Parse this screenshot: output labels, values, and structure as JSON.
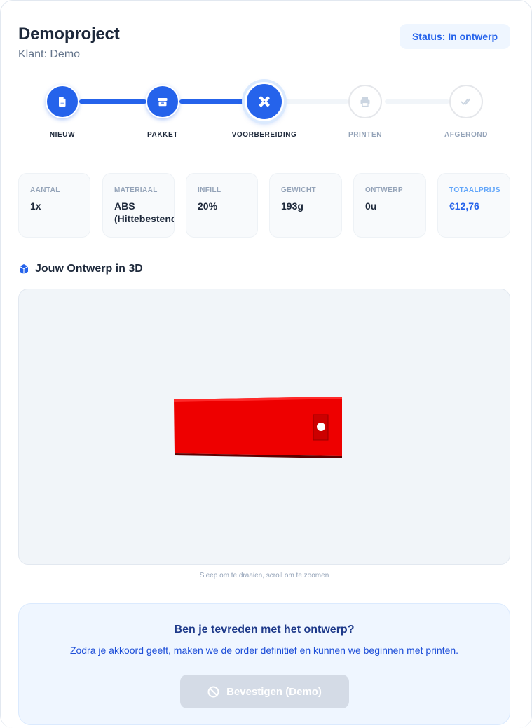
{
  "header": {
    "project_title": "Demoproject",
    "client": "Klant: Demo",
    "status": "Status: In ontwerp"
  },
  "steps": [
    {
      "label": "NIEUW",
      "icon": "document-icon",
      "state": "done"
    },
    {
      "label": "PAKKET",
      "icon": "package-icon",
      "state": "done"
    },
    {
      "label": "VOORBEREIDING",
      "icon": "design-tools-icon",
      "state": "active"
    },
    {
      "label": "PRINTEN",
      "icon": "printer-icon",
      "state": "todo"
    },
    {
      "label": "AFGEROND",
      "icon": "double-check-icon",
      "state": "todo"
    }
  ],
  "stats": [
    {
      "label": "AANTAL",
      "value": "1x"
    },
    {
      "label": "MATERIAAL",
      "value": "ABS",
      "value2": "(Hittebestendig)"
    },
    {
      "label": "INFILL",
      "value": "20%"
    },
    {
      "label": "GEWICHT",
      "value": "193g"
    },
    {
      "label": "ONTWERP",
      "value": "0u"
    },
    {
      "label": "TOTAALPRIJS",
      "value": "€12,76"
    }
  ],
  "viewer": {
    "title": "Jouw Ontwerp in 3D",
    "hint": "Sleep om te draaien, scroll om te zoomen",
    "model_color": "#ee0000",
    "background_color": "#f1f5f9"
  },
  "confirm": {
    "question": "Ben je tevreden met het ontwerp?",
    "text": "Zodra je akkoord geeft, maken we de order definitief en kunnen we beginnen met printen.",
    "button_label": "Bevestigen (Demo)"
  },
  "colors": {
    "accent": "#2563eb",
    "accent_light": "#eff6ff",
    "inactive": "#94a3b8"
  }
}
